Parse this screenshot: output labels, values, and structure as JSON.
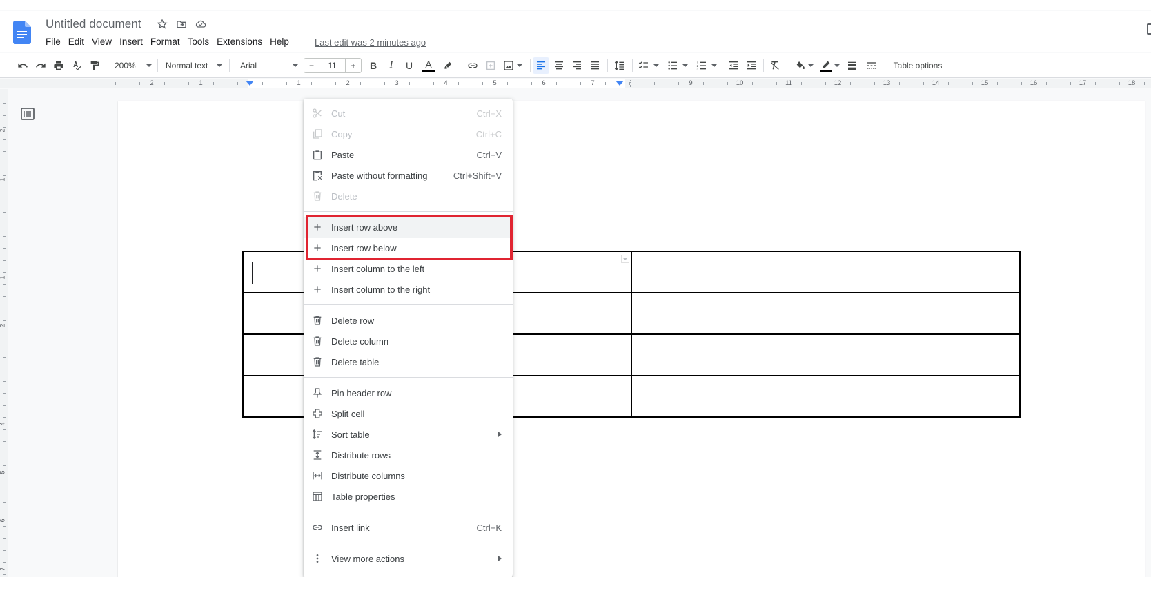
{
  "header": {
    "doc_title": "Untitled document",
    "title_icons": [
      "star-icon",
      "move-to-folder-icon",
      "cloud-saved-icon"
    ],
    "menus": [
      "File",
      "Edit",
      "View",
      "Insert",
      "Format",
      "Tools",
      "Extensions",
      "Help"
    ],
    "last_edit": "Last edit was 2 minutes ago"
  },
  "toolbar": {
    "zoom": "200%",
    "style": "Normal text",
    "font": "Arial",
    "font_size": "11",
    "minus": "−",
    "plus": "+",
    "bold": "B",
    "italic": "I",
    "underline": "U",
    "text_color": "A",
    "table_options": "Table options"
  },
  "ruler": {
    "labels_left": [
      "2",
      "1"
    ],
    "labels_main": [
      "1",
      "2",
      "3",
      "4",
      "5",
      "6",
      "7"
    ],
    "labels_right": [
      "9",
      "10",
      "11",
      "12",
      "13",
      "14",
      "15",
      "16",
      "17",
      "18"
    ]
  },
  "vruler": {
    "labels": [
      "2",
      "1",
      "1",
      "2",
      "4",
      "5",
      "6",
      "7"
    ]
  },
  "table": {
    "rows": 4,
    "cols": 2,
    "cells": [
      [
        "",
        ""
      ],
      [
        "",
        ""
      ],
      [
        "",
        ""
      ],
      [
        "",
        ""
      ]
    ]
  },
  "context_menu": {
    "groups": [
      [
        {
          "label": "Cut",
          "shortcut": "Ctrl+X",
          "icon": "scissors-icon",
          "disabled": true
        },
        {
          "label": "Copy",
          "shortcut": "Ctrl+C",
          "icon": "copy-icon",
          "disabled": true
        },
        {
          "label": "Paste",
          "shortcut": "Ctrl+V",
          "icon": "clipboard-icon",
          "disabled": false
        },
        {
          "label": "Paste without formatting",
          "shortcut": "Ctrl+Shift+V",
          "icon": "paste-plain-icon",
          "disabled": false
        },
        {
          "label": "Delete",
          "shortcut": "",
          "icon": "trash-icon",
          "disabled": true
        }
      ],
      [
        {
          "label": "Insert row above",
          "icon": "plus-icon",
          "hovered": true
        },
        {
          "label": "Insert row below",
          "icon": "plus-icon"
        },
        {
          "label": "Insert column to the left",
          "icon": "plus-icon"
        },
        {
          "label": "Insert column to the right",
          "icon": "plus-icon"
        }
      ],
      [
        {
          "label": "Delete row",
          "icon": "trash-icon"
        },
        {
          "label": "Delete column",
          "icon": "trash-icon"
        },
        {
          "label": "Delete table",
          "icon": "trash-icon"
        }
      ],
      [
        {
          "label": "Pin header row",
          "icon": "pin-icon"
        },
        {
          "label": "Split cell",
          "icon": "split-cell-icon"
        },
        {
          "label": "Sort table",
          "icon": "sort-icon",
          "submenu": true
        },
        {
          "label": "Distribute rows",
          "icon": "distribute-rows-icon"
        },
        {
          "label": "Distribute columns",
          "icon": "distribute-columns-icon"
        },
        {
          "label": "Table properties",
          "icon": "table-properties-icon"
        }
      ],
      [
        {
          "label": "Insert link",
          "shortcut": "Ctrl+K",
          "icon": "link-icon"
        }
      ],
      [
        {
          "label": "View more actions",
          "icon": "more-vert-icon",
          "submenu": true
        }
      ]
    ]
  },
  "annotation": {
    "highlight_color": "#e02431",
    "highlighted_items": [
      "Insert row above",
      "Insert row below"
    ]
  }
}
